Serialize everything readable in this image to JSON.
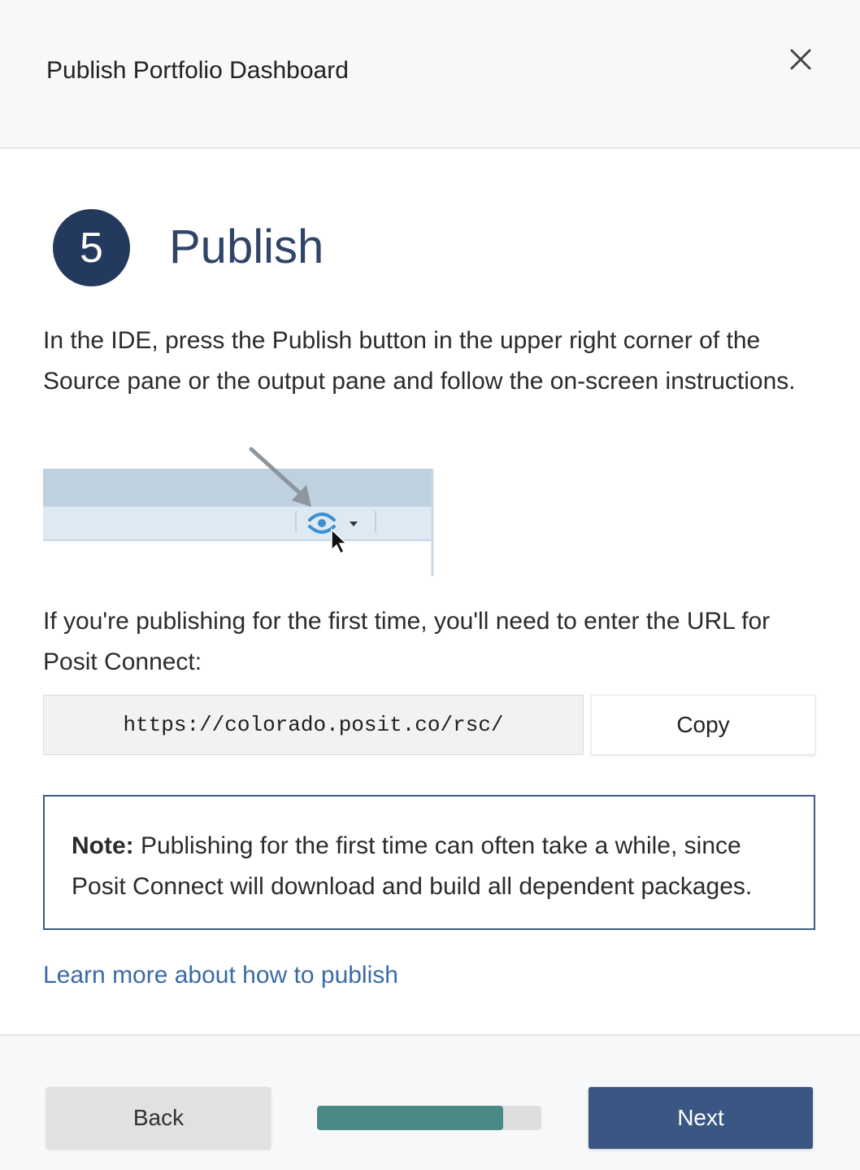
{
  "dialog": {
    "title": "Publish Portfolio Dashboard",
    "close_icon": "close-icon"
  },
  "step": {
    "number": "5",
    "title": "Publish"
  },
  "instructions": {
    "paragraph1": "In the IDE, press the Publish button in the upper right corner of the Source pane or the output pane and follow the on-screen instructions.",
    "paragraph2": "If you're publishing for the first time, you'll need to enter the URL for Posit Connect:"
  },
  "illustration": {
    "icons": [
      "arrow-pointer-icon",
      "publish-icon",
      "dropdown-caret-icon",
      "mouse-cursor-icon"
    ]
  },
  "url": {
    "value": "https://colorado.posit.co/rsc/",
    "copy_label": "Copy"
  },
  "note": {
    "label": "Note:",
    "text": " Publishing for the first time can often take a while, since Posit Connect will download and build all dependent packages."
  },
  "learn_more": {
    "label": "Learn more about how to publish"
  },
  "footer": {
    "back_label": "Back",
    "next_label": "Next",
    "progress_fraction": 0.83
  },
  "colors": {
    "badge": "#233a5e",
    "title": "#2f4468",
    "link": "#3a6ba3",
    "note_border": "#3b5b85",
    "progress_fill": "#4a8a86",
    "next_button": "#3a5783",
    "back_button": "#e1e1e1"
  }
}
